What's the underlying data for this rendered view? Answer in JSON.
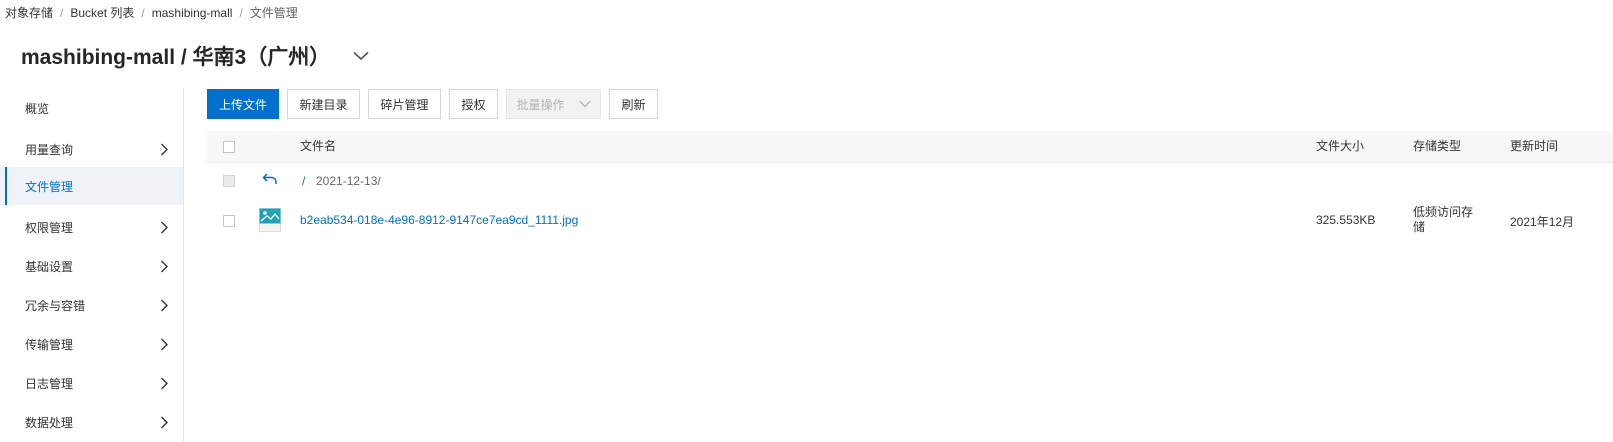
{
  "breadcrumb": {
    "items": [
      "对象存储",
      "Bucket 列表",
      "mashibing-mall",
      "文件管理"
    ],
    "separator": "/"
  },
  "page_title": "mashibing-mall / 华南3（广州）",
  "sidebar": {
    "items": [
      {
        "label": "概览",
        "has_chevron": false,
        "active": false
      },
      {
        "label": "用量查询",
        "has_chevron": true,
        "active": false
      },
      {
        "label": "文件管理",
        "has_chevron": false,
        "active": true
      },
      {
        "label": "权限管理",
        "has_chevron": true,
        "active": false
      },
      {
        "label": "基础设置",
        "has_chevron": true,
        "active": false
      },
      {
        "label": "冗余与容错",
        "has_chevron": true,
        "active": false
      },
      {
        "label": "传输管理",
        "has_chevron": true,
        "active": false
      },
      {
        "label": "日志管理",
        "has_chevron": true,
        "active": false
      },
      {
        "label": "数据处理",
        "has_chevron": true,
        "active": false
      }
    ]
  },
  "toolbar": {
    "upload_label": "上传文件",
    "new_dir_label": "新建目录",
    "fragment_label": "碎片管理",
    "authorize_label": "授权",
    "batch_label": "批量操作",
    "refresh_label": "刷新"
  },
  "table": {
    "columns": {
      "name": "文件名",
      "size": "文件大小",
      "storage": "存储类型",
      "updated": "更新时间"
    },
    "path_row": {
      "root_link": "/",
      "path": "2021-12-13/"
    },
    "rows": [
      {
        "name": "b2eab534-018e-4e96-8912-9147ce7ea9cd_1111.jpg",
        "size": "325.553KB",
        "storage_line1": "低频访问存",
        "storage_line2": "储",
        "updated": "2021年12月"
      }
    ]
  },
  "colors": {
    "primary": "#0070cc",
    "sidebar_active_bg": "#eff3f8",
    "header_bg": "#f7f7f7",
    "image_icon": "#1fa3b8"
  }
}
